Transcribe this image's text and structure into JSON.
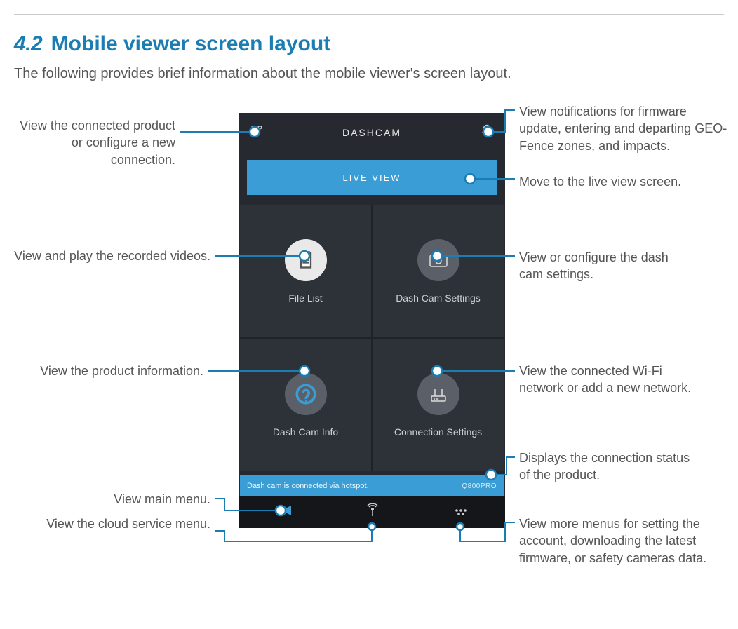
{
  "section": {
    "number": "4.2",
    "title": "Mobile viewer screen layout"
  },
  "intro": "The following provides brief information about the mobile viewer's screen layout.",
  "phone": {
    "header_title": "DASHCAM",
    "live_button": "LIVE VIEW",
    "tiles": {
      "file_list": "File List",
      "settings": "Dash Cam Settings",
      "info": "Dash Cam Info",
      "connection": "Connection Settings"
    },
    "status_text": "Dash cam is connected via hotspot.",
    "status_model": "Q800PRO"
  },
  "callouts": {
    "network": "View the connected product or configure a new connection.",
    "notifications": "View notifications for firmware update, entering and departing GEO-Fence zones, and impacts.",
    "live": "Move to the live view screen.",
    "file_list": "View and play the recorded videos.",
    "settings": "View or configure the dash cam settings.",
    "info": "View the product information.",
    "connection": "View the connected Wi-Fi network or add a new network.",
    "status": "Displays the connection status of the product.",
    "main_menu": "View main menu.",
    "cloud_menu": "View the cloud service menu.",
    "more_menu": "View more menus for setting the account, downloading the latest firmware, or safety cameras data."
  }
}
